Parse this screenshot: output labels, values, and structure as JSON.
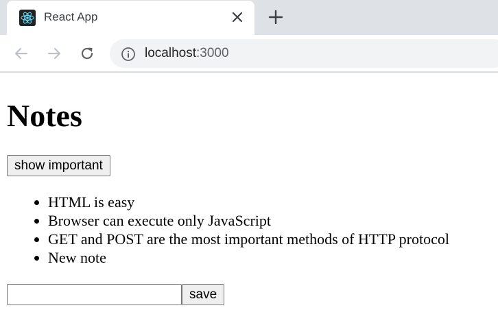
{
  "browser": {
    "tab": {
      "title": "React App",
      "favicon": "react-logo-icon"
    },
    "address_bar": {
      "host": "localhost",
      "port": ":3000"
    },
    "icons": [
      "back-icon",
      "forward-icon",
      "reload-icon",
      "info-icon",
      "close-icon",
      "plus-icon"
    ]
  },
  "page": {
    "heading": "Notes",
    "toggle_button_label": "show important",
    "notes": [
      "HTML is easy",
      "Browser can execute only JavaScript",
      "GET and POST are the most important methods of HTTP protocol",
      "New note"
    ],
    "new_note_input": {
      "value": ""
    },
    "save_button_label": "save"
  }
}
